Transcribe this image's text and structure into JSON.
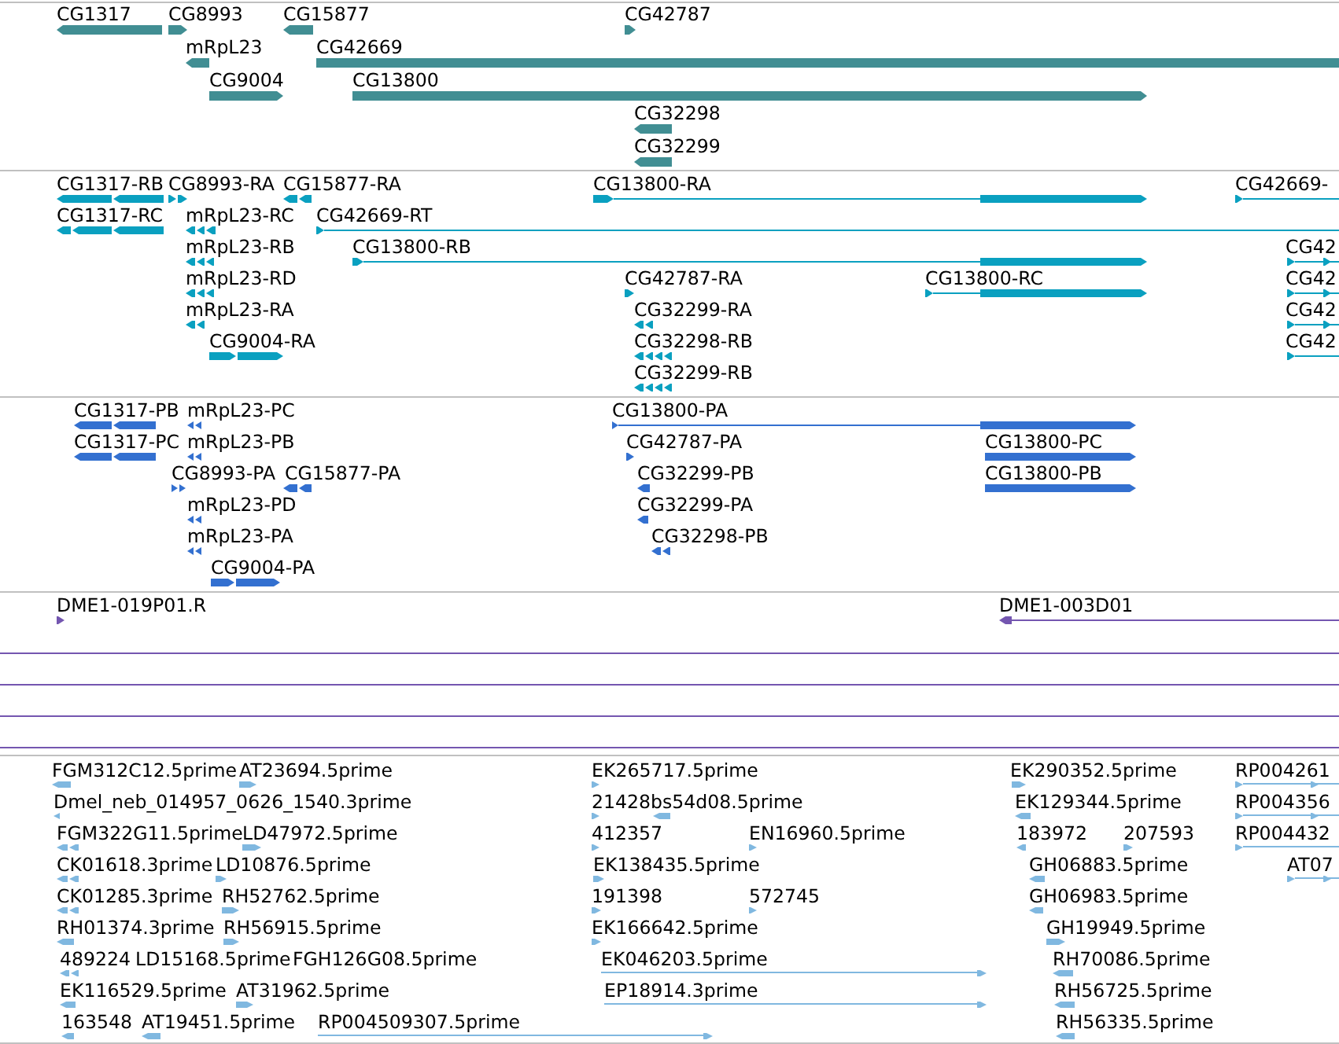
{
  "tracks": [
    {
      "kind": "gene",
      "features": [
        {
          "label": "CG1317",
          "reverse": true
        },
        {
          "label": "CG8993",
          "reverse": false
        },
        {
          "label": "CG15877",
          "reverse": true
        },
        {
          "label": "CG42787",
          "reverse": false
        },
        {
          "label": "mRpL23",
          "reverse": true
        },
        {
          "label": "CG42669",
          "reverse": false
        },
        {
          "label": "CG9004",
          "reverse": false
        },
        {
          "label": "CG13800",
          "reverse": false
        },
        {
          "label": "CG32298",
          "reverse": true
        },
        {
          "label": "CG32299",
          "reverse": true
        }
      ]
    },
    {
      "kind": "transcript",
      "features": [
        {
          "label": "CG1317-RB",
          "reverse": true
        },
        {
          "label": "CG8993-RA",
          "reverse": false
        },
        {
          "label": "CG15877-RA",
          "reverse": true
        },
        {
          "label": "CG13800-RA",
          "reverse": false
        },
        {
          "label": "CG42669-",
          "reverse": false
        },
        {
          "label": "CG1317-RC",
          "reverse": true
        },
        {
          "label": "mRpL23-RC",
          "reverse": true
        },
        {
          "label": "CG42669-RT",
          "reverse": false
        },
        {
          "label": "mRpL23-RB",
          "reverse": true
        },
        {
          "label": "CG13800-RB",
          "reverse": false
        },
        {
          "label": "CG42",
          "reverse": false
        },
        {
          "label": "mRpL23-RD",
          "reverse": true
        },
        {
          "label": "CG42787-RA",
          "reverse": false
        },
        {
          "label": "CG13800-RC",
          "reverse": false
        },
        {
          "label": "CG42",
          "reverse": false
        },
        {
          "label": "mRpL23-RA",
          "reverse": true
        },
        {
          "label": "CG32299-RA",
          "reverse": true
        },
        {
          "label": "CG42",
          "reverse": false
        },
        {
          "label": "CG9004-RA",
          "reverse": false
        },
        {
          "label": "CG32298-RB",
          "reverse": true
        },
        {
          "label": "CG42",
          "reverse": false
        },
        {
          "label": "CG32299-RB",
          "reverse": true
        }
      ]
    },
    {
      "kind": "protein",
      "features": [
        {
          "label": "CG1317-PB",
          "reverse": true
        },
        {
          "label": "mRpL23-PC",
          "reverse": true
        },
        {
          "label": "CG13800-PA",
          "reverse": false
        },
        {
          "label": "CG1317-PC",
          "reverse": true
        },
        {
          "label": "mRpL23-PB",
          "reverse": true
        },
        {
          "label": "CG42787-PA",
          "reverse": false
        },
        {
          "label": "CG13800-PC",
          "reverse": false
        },
        {
          "label": "CG8993-PA",
          "reverse": false
        },
        {
          "label": "CG15877-PA",
          "reverse": true
        },
        {
          "label": "CG32299-PB",
          "reverse": true
        },
        {
          "label": "CG13800-PB",
          "reverse": false
        },
        {
          "label": "mRpL23-PD",
          "reverse": true
        },
        {
          "label": "CG32299-PA",
          "reverse": true
        },
        {
          "label": "mRpL23-PA",
          "reverse": true
        },
        {
          "label": "CG32298-PB",
          "reverse": true
        },
        {
          "label": "CG9004-PA",
          "reverse": false
        }
      ]
    },
    {
      "kind": "clone",
      "features": [
        {
          "label": "DME1-019P01.R",
          "reverse": false
        },
        {
          "label": "DME1-003D01",
          "reverse": true
        }
      ]
    },
    {
      "kind": "est",
      "features": [
        {
          "label": "FGM312C12.5prime",
          "reverse": true
        },
        {
          "label": "AT23694.5prime",
          "reverse": false
        },
        {
          "label": "EK265717.5prime",
          "reverse": false
        },
        {
          "label": "EK290352.5prime",
          "reverse": false
        },
        {
          "label": "RP004261",
          "reverse": false
        },
        {
          "label": "Dmel_neb_014957_0626_1540.3prime",
          "reverse": true
        },
        {
          "label": "21428bs54d08.5prime",
          "reverse": false
        },
        {
          "reverse": true
        },
        {
          "label": "EK129344.5prime",
          "reverse": true
        },
        {
          "label": "RP004356",
          "reverse": false
        },
        {
          "label": "FGM322G11.5prime",
          "reverse": true
        },
        {
          "label": "LD47972.5prime",
          "reverse": false
        },
        {
          "label": "412357",
          "reverse": false
        },
        {
          "label": "EN16960.5prime",
          "reverse": false
        },
        {
          "label": "183972",
          "reverse": true
        },
        {
          "label": "207593",
          "reverse": false
        },
        {
          "label": "RP004432",
          "reverse": false
        },
        {
          "label": "CK01618.3prime",
          "reverse": true
        },
        {
          "label": "LD10876.5prime",
          "reverse": false
        },
        {
          "label": "EK138435.5prime",
          "reverse": false
        },
        {
          "label": "GH06883.5prime",
          "reverse": true
        },
        {
          "label": "AT07",
          "reverse": false
        },
        {
          "label": "CK01285.3prime",
          "reverse": true
        },
        {
          "label": "RH52762.5prime",
          "reverse": false
        },
        {
          "label": "191398",
          "reverse": false
        },
        {
          "label": "572745",
          "reverse": false
        },
        {
          "label": "GH06983.5prime",
          "reverse": true
        },
        {
          "label": "RH01374.3prime",
          "reverse": true
        },
        {
          "label": "RH56915.5prime",
          "reverse": false
        },
        {
          "label": "EK166642.5prime",
          "reverse": false
        },
        {
          "label": "GH19949.5prime",
          "reverse": false
        },
        {
          "label": "489224",
          "reverse": true
        },
        {
          "label": "LD15168.5prime"
        },
        {
          "label": "FGH126G08.5prime"
        },
        {
          "label": "EK046203.5prime",
          "reverse": false
        },
        {
          "label": "RH70086.5prime",
          "reverse": true
        },
        {
          "label": "EK116529.5prime",
          "reverse": true
        },
        {
          "label": "AT31962.5prime",
          "reverse": false
        },
        {
          "label": "EP18914.3prime",
          "reverse": false
        },
        {
          "label": "RH56725.5prime",
          "reverse": true
        },
        {
          "label": "163548",
          "reverse": true
        },
        {
          "label": "AT19451.5prime",
          "reverse": true
        },
        {
          "label": "RP004509307.5prime",
          "reverse": false
        },
        {
          "label": "RH56335.5prime",
          "reverse": true
        }
      ]
    }
  ]
}
